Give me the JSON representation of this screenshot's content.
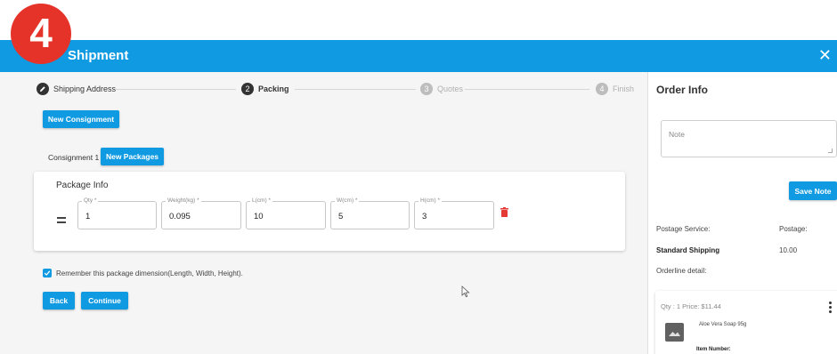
{
  "step_badge": "4",
  "header": {
    "title": "Shipment",
    "close": "✕"
  },
  "stepper": [
    {
      "label": "Shipping Address",
      "state": "done",
      "icon": "pencil-icon"
    },
    {
      "number": "2",
      "label": "Packing",
      "state": "active"
    },
    {
      "number": "3",
      "label": "Quotes",
      "state": "inactive"
    },
    {
      "number": "4",
      "label": "Finish",
      "state": "inactive"
    }
  ],
  "buttons": {
    "new_consignment": "New Consignment",
    "new_packages": "New Packages",
    "back": "Back",
    "continue": "Continue",
    "save_note": "Save Note"
  },
  "consignment_tab": "Consignment 1",
  "package": {
    "title": "Package Info",
    "fields": [
      {
        "label": "Qty *",
        "value": "1"
      },
      {
        "label": "Weight(kg) *",
        "value": "0.095"
      },
      {
        "label": "L(cm) *",
        "value": "10"
      },
      {
        "label": "W(cm) *",
        "value": "5"
      },
      {
        "label": "H(cm) *",
        "value": "3"
      }
    ]
  },
  "remember_label": "Remember this package dimension(Length, Width, Height).",
  "remember_checked": true,
  "order_info": {
    "title": "Order Info",
    "note_placeholder": "Note",
    "postage_service_label": "Postage Service:",
    "postage_label": "Postage:",
    "service": "Standard Shipping",
    "postage_value": "10.00",
    "orderline_label": "Orderline detail:",
    "item": {
      "qty_price": "Qty : 1 Price: $11.44",
      "name": "Aloe Vera Soap 95g",
      "item_number_label": "Item Number:"
    }
  },
  "colors": {
    "accent": "#0f9ae2",
    "badge": "#e5332a",
    "trash": "#e53935"
  }
}
